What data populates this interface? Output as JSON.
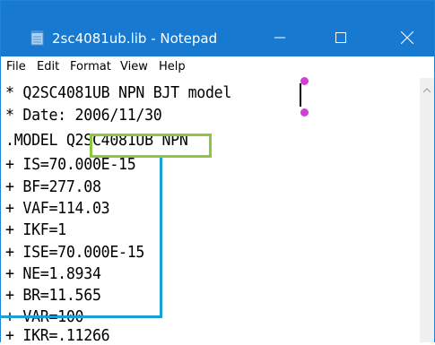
{
  "window": {
    "title": "2sc4081ub.lib - Notepad",
    "accent": "#1879d0"
  },
  "controls": {
    "minimize_icon": "minimize-icon",
    "maximize_icon": "maximize-icon",
    "close_icon": "close-icon"
  },
  "menu": {
    "items": [
      "File",
      "Edit",
      "Format",
      "View",
      "Help"
    ]
  },
  "editor": {
    "lines": [
      "* Q2SC4081UB NPN BJT model",
      "* Date: 2006/11/30",
      ".MODEL Q2SC4081UB NPN",
      "+ IS=70.000E-15",
      "+ BF=277.08",
      "+ VAF=114.03",
      "+ IKF=1",
      "+ ISE=70.000E-15",
      "+ NE=1.8934",
      "+ BR=11.565",
      "+ VAR=100",
      "+ IKR=.11266"
    ]
  },
  "annotations": {
    "green_box_color": "#8dc63f",
    "blue_bracket_color": "#1a9fd6",
    "selection_handle_color": "#d13fd4"
  }
}
